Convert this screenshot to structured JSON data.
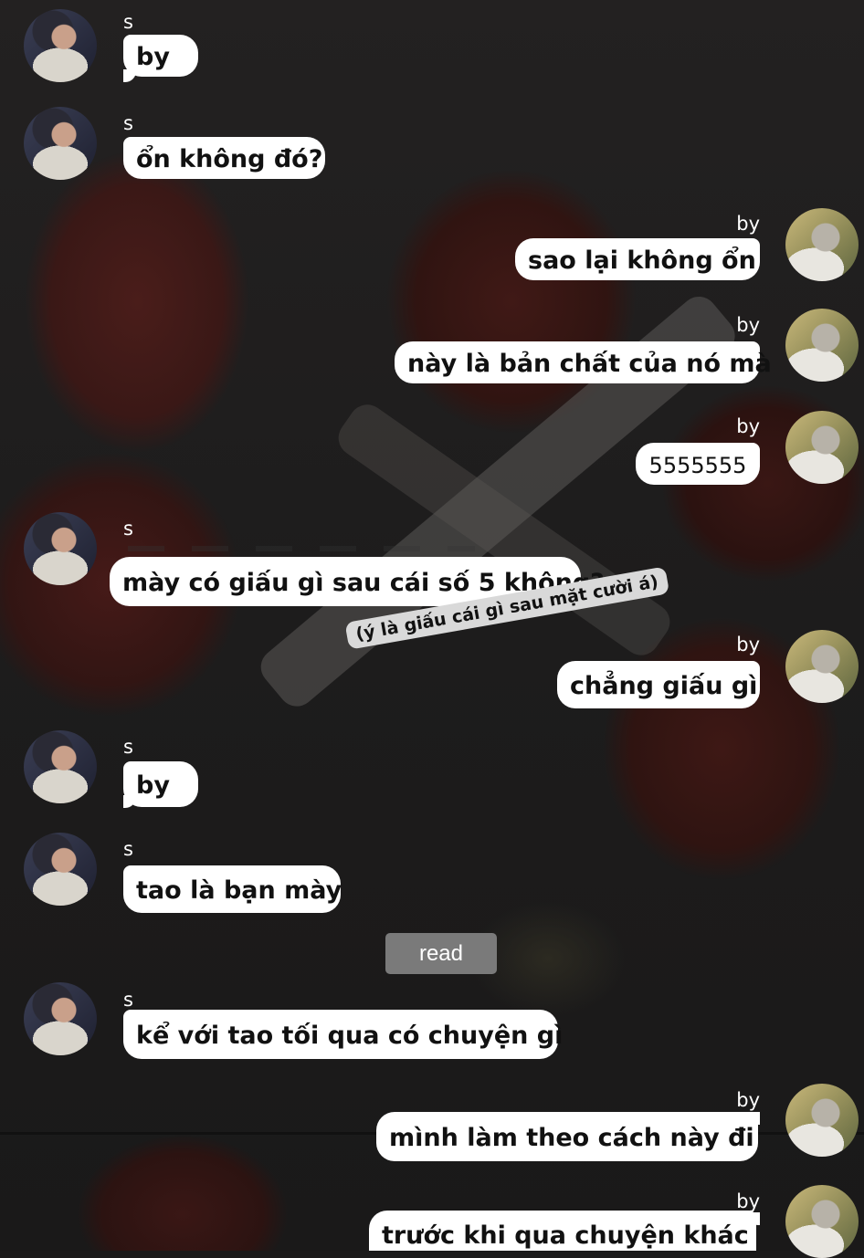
{
  "colors": {
    "bubble": "#ffffff",
    "note": "#d9d9d9",
    "read_button": "#7a7a7a",
    "text": "#111111"
  },
  "contacts": {
    "left": "s",
    "right": "by"
  },
  "messages": [
    {
      "sender": "s",
      "text": "by"
    },
    {
      "sender": "s",
      "text": "ổn không đó?"
    },
    {
      "sender": "by",
      "text": "sao lại không ổn"
    },
    {
      "sender": "by",
      "text": "này là bản chất của nó mà"
    },
    {
      "sender": "by",
      "text": "5555555"
    },
    {
      "sender": "s",
      "text": "mày có giấu gì sau cái số 5 không?"
    },
    {
      "sender": "by",
      "text": "chẳng giấu gì"
    },
    {
      "sender": "s",
      "text": "by"
    },
    {
      "sender": "s",
      "text": "tao là bạn mày"
    },
    {
      "sender": "s",
      "text": "kể với tao tối qua có chuyện gì"
    },
    {
      "sender": "by",
      "text": "mình làm theo cách này đi"
    },
    {
      "sender": "by",
      "text": "trước khi qua chuyện khác"
    }
  ],
  "note": "(ý là giấu cái gì sau mặt cười á)",
  "read_label": "read",
  "avatar_icons": {
    "left": "avatar-s-icon",
    "right": "avatar-by-icon"
  }
}
